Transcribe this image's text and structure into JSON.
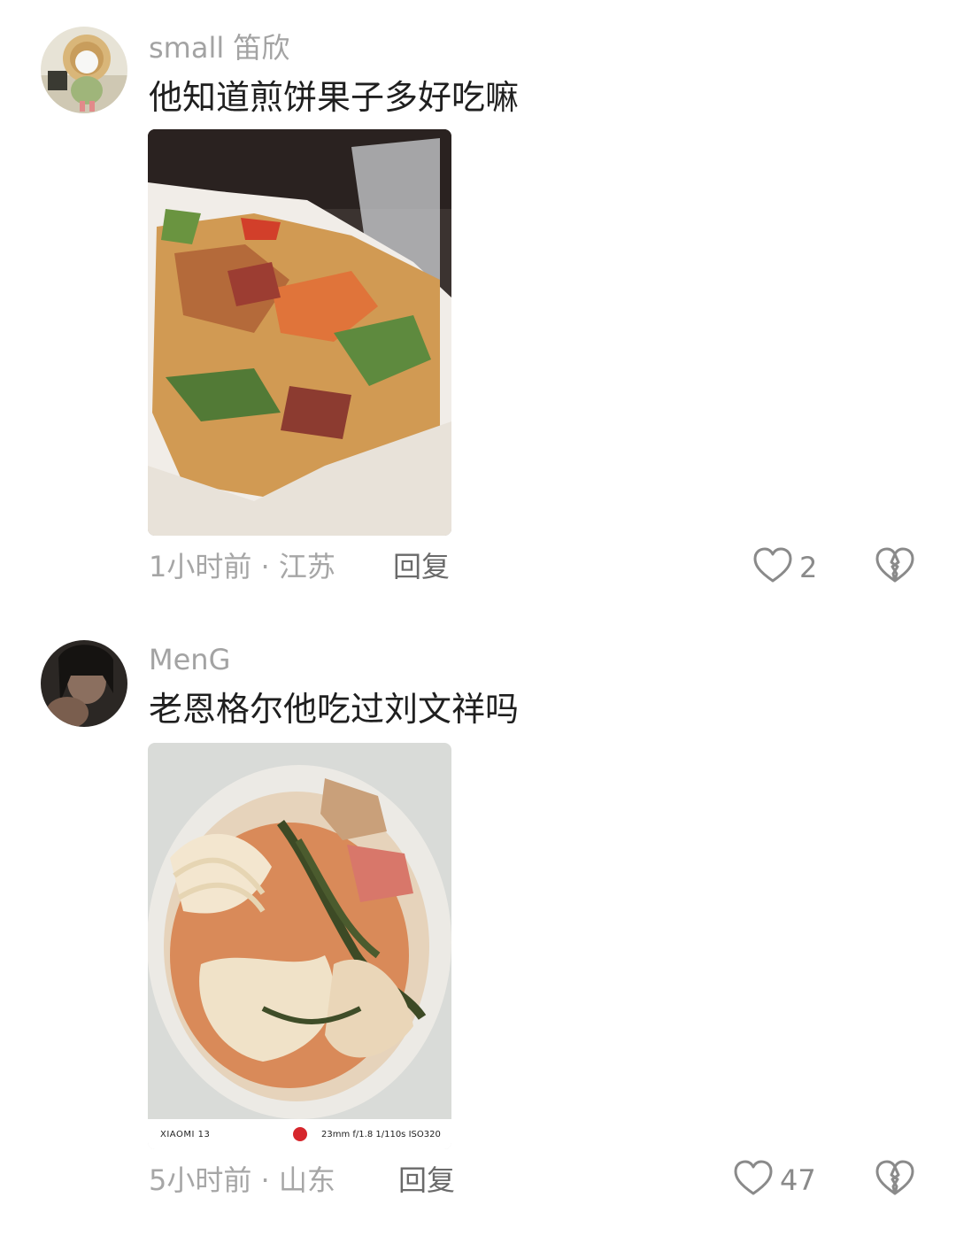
{
  "comments": [
    {
      "username": "small 笛欣",
      "text": "他知道煎饼果子多好吃嘛",
      "time": "1小时前",
      "separator": "·",
      "location": "江苏",
      "reply_label": "回复",
      "likes": "2"
    },
    {
      "username": "MenG",
      "text": "老恩格尔他吃过刘文祥吗",
      "time": "5小时前",
      "separator": "·",
      "location": "山东",
      "reply_label": "回复",
      "likes": "47",
      "exif": {
        "model": "XIAOMI 13",
        "params": "23mm  f/1.8  1/110s  ISO320"
      }
    }
  ],
  "colors": {
    "username": "#a3a3a3",
    "text": "#1f1f1f",
    "meta": "#a6a6a6",
    "icon": "#8a8a8a"
  }
}
